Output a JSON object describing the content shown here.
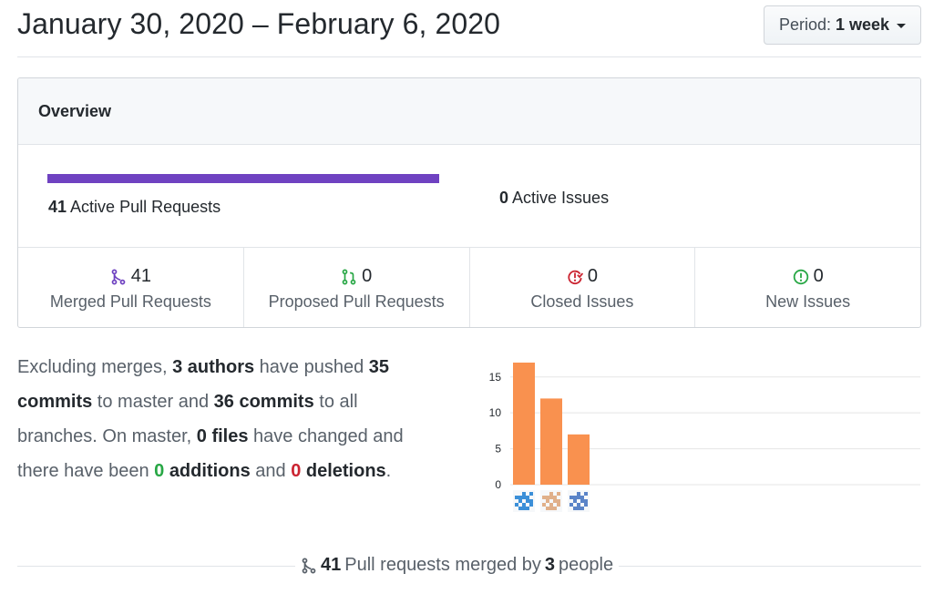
{
  "header": {
    "title": "January 30, 2020 – February 6, 2020",
    "period_label": "Period:",
    "period_value": "1 week"
  },
  "overview": {
    "heading": "Overview",
    "active_prs_count": "41",
    "active_prs_label": "Active Pull Requests",
    "active_issues_count": "0",
    "active_issues_label": "Active Issues",
    "pr_bar_color": "#6f42c1",
    "stats": [
      {
        "count": "41",
        "label": "Merged Pull Requests",
        "icon": "git-merge-icon",
        "color": "#6f42c1"
      },
      {
        "count": "0",
        "label": "Proposed Pull Requests",
        "icon": "git-pull-request-icon",
        "color": "#28a745"
      },
      {
        "count": "0",
        "label": "Closed Issues",
        "icon": "issue-closed-icon",
        "color": "#cb2431"
      },
      {
        "count": "0",
        "label": "New Issues",
        "icon": "issue-opened-icon",
        "color": "#28a745"
      }
    ]
  },
  "summary": {
    "t1": "Excluding merges, ",
    "authors": "3 authors",
    "t2": " have pushed ",
    "commits_master": "35 commits",
    "t3": " to master and ",
    "commits_all": "36 commits",
    "t4": " to all branches. On master, ",
    "files": "0 files",
    "t5": " have changed and there have been ",
    "additions_num": "0",
    "additions_word": "additions",
    "t6": " and ",
    "deletions_num": "0",
    "deletions_word": "deletions",
    "t7": "."
  },
  "chart_data": {
    "type": "bar",
    "categories": [
      "author-1",
      "author-2",
      "author-3"
    ],
    "values": [
      17,
      12,
      7
    ],
    "ylim": [
      0,
      17
    ],
    "yticks": [
      0,
      5,
      10,
      15
    ],
    "bar_color": "#f9914f",
    "grid": true
  },
  "footer": {
    "count": "41",
    "t1": "Pull requests merged by",
    "people": "3",
    "t2": "people"
  }
}
